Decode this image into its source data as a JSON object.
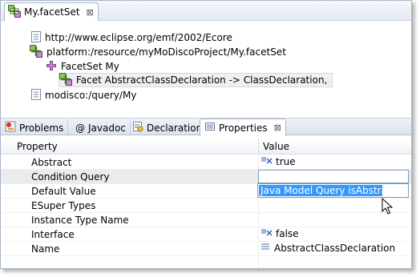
{
  "editor": {
    "tab_title": "My.facetSet",
    "tab_close": "⊠"
  },
  "tree": {
    "items": [
      {
        "label": "http://www.eclipse.org/emf/2002/Ecore",
        "icon": "resource-doc-icon"
      },
      {
        "label": "platform:/resource/myMoDiscoProject/My.facetSet",
        "icon": "facetset-resource-icon"
      },
      {
        "label": "FacetSet My",
        "icon": "facetset-icon"
      },
      {
        "label": "Facet AbstractClassDeclaration -> ClassDeclaration,",
        "icon": "facet-icon"
      },
      {
        "label": "modisco:/query/My",
        "icon": "resource-doc-icon"
      }
    ]
  },
  "views": {
    "tabs": [
      {
        "label": "Problems",
        "icon": "problems-icon"
      },
      {
        "label": "Javadoc",
        "icon": "at-icon"
      },
      {
        "label": "Declaration",
        "icon": "declaration-icon"
      },
      {
        "label": "Properties",
        "icon": "properties-icon",
        "active": true
      }
    ],
    "close": "⊠"
  },
  "properties": {
    "col_property": "Property",
    "col_value": "Value",
    "rows": [
      {
        "name": "Abstract",
        "value": "true"
      },
      {
        "name": "Condition Query",
        "value": ""
      },
      {
        "name": "Default Value",
        "value": ""
      },
      {
        "name": "ESuper Types",
        "value": ""
      },
      {
        "name": "Instance Type Name",
        "value": ""
      },
      {
        "name": "Interface",
        "value": "false"
      },
      {
        "name": "Name",
        "value": "AbstractClassDeclaration"
      }
    ],
    "dropdown_option": "Java Model Query isAbstract"
  },
  "colors": {
    "selection": "#3399ff",
    "tab_border": "#a9b6c8"
  }
}
